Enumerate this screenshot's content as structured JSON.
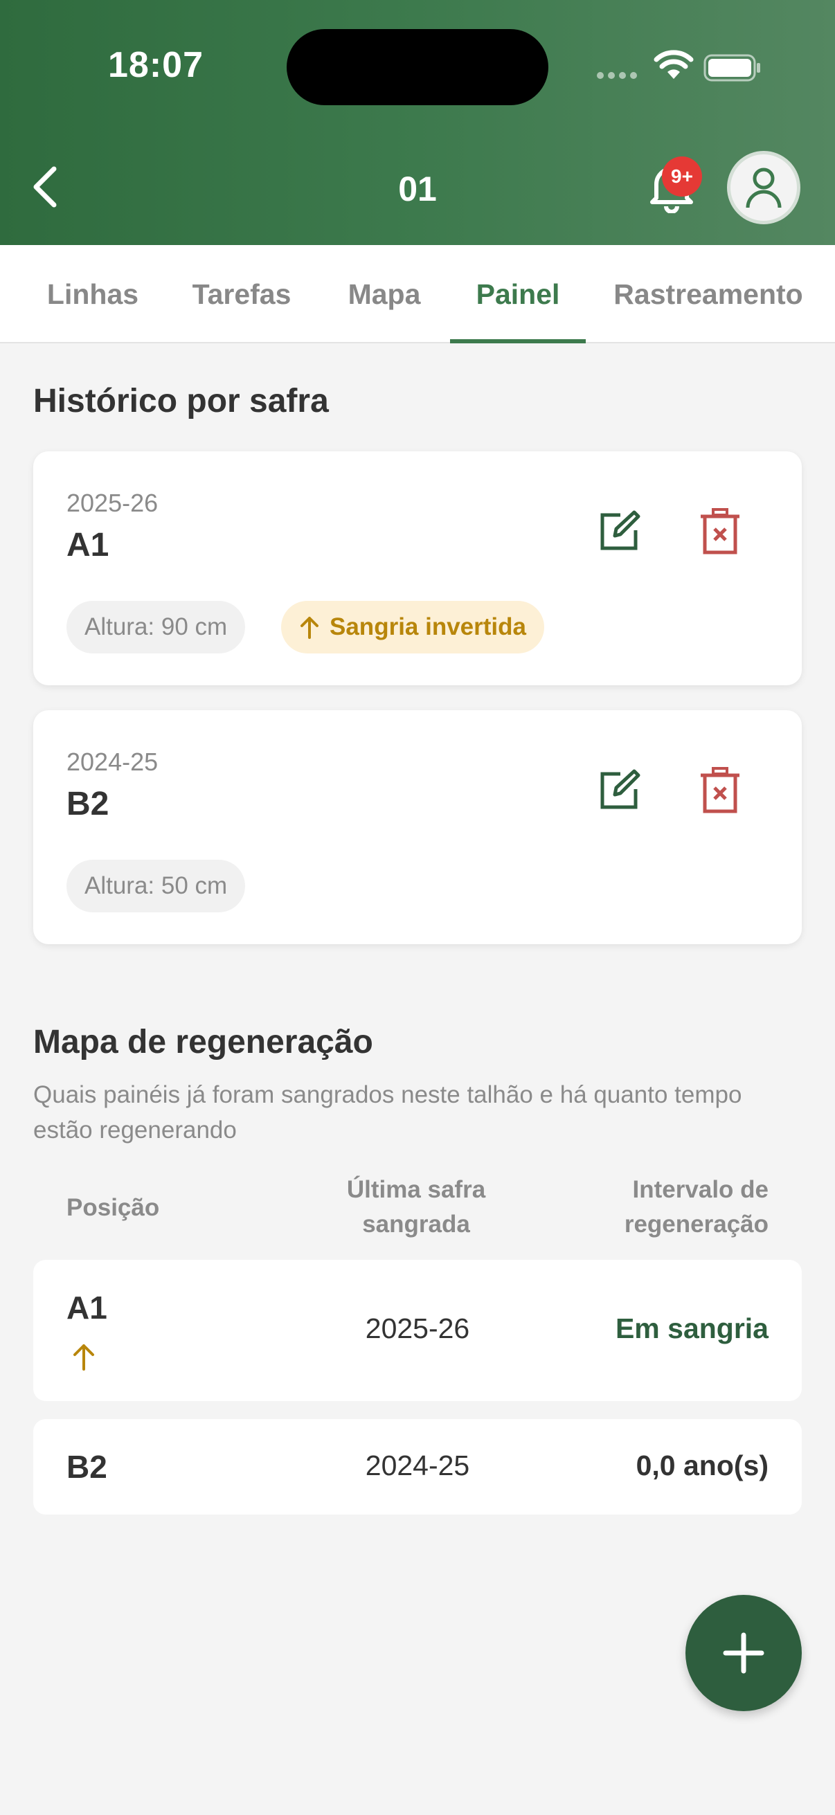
{
  "status_bar": {
    "time": "18:07"
  },
  "nav": {
    "title": "01",
    "notification_badge": "9+"
  },
  "tabs": [
    {
      "label": "Linhas",
      "active": false
    },
    {
      "label": "Tarefas",
      "active": false
    },
    {
      "label": "Mapa",
      "active": false
    },
    {
      "label": "Painel",
      "active": true
    },
    {
      "label": "Rastreamento",
      "active": false
    }
  ],
  "history": {
    "title": "Histórico por safra",
    "cards": [
      {
        "season": "2025-26",
        "position": "A1",
        "height_chip": "Altura: 90 cm",
        "tag": "Sangria invertida"
      },
      {
        "season": "2024-25",
        "position": "B2",
        "height_chip": "Altura: 50 cm"
      }
    ]
  },
  "regeneration": {
    "title": "Mapa de regeneração",
    "subtitle": "Quais painéis já foram sangrados neste talhão e há quanto tempo estão regenerando",
    "headers": {
      "position": "Posição",
      "last_season_1": "Última safra",
      "last_season_2": "sangrada",
      "interval_1": "Intervalo de",
      "interval_2": "regeneração"
    },
    "rows": [
      {
        "position": "A1",
        "season": "2025-26",
        "interval": "Em sangria"
      },
      {
        "position": "B2",
        "season": "2024-25",
        "interval": "0,0 ano(s)"
      }
    ]
  },
  "colors": {
    "header_green": "#3d7a4d",
    "accent_green": "#2e5e3e",
    "delete_red": "#c0504d",
    "amber": "#b8860b"
  }
}
